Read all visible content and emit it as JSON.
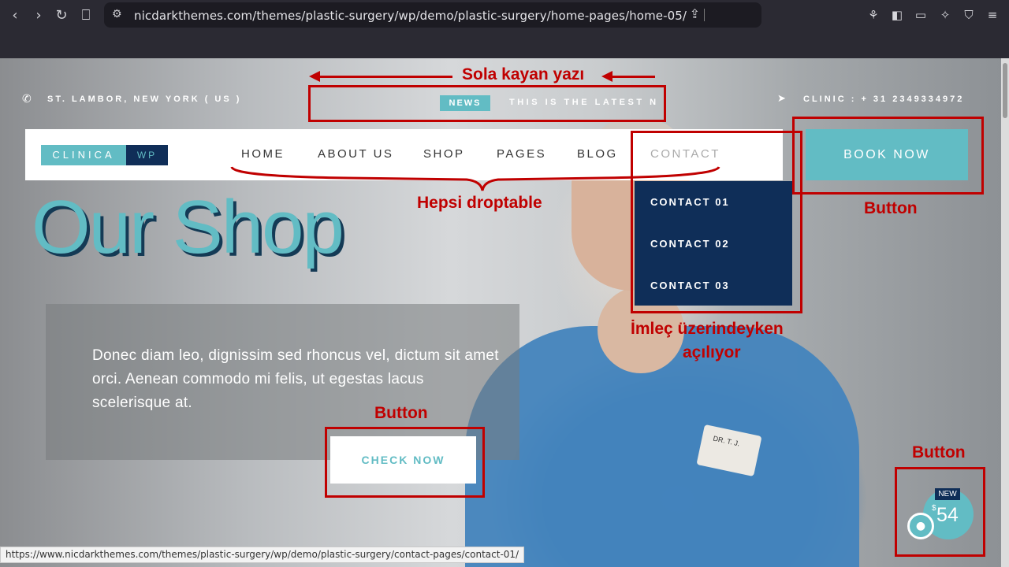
{
  "browser": {
    "url": "nicdarkthemes.com/themes/plastic-surgery/wp/demo/plastic-surgery/home-pages/home-05/",
    "status_url": "https://www.nicdarkthemes.com/themes/plastic-surgery/wp/demo/plastic-surgery/contact-pages/contact-01/"
  },
  "topbar": {
    "address": "ST. LAMBOR, NEW YORK ( US )",
    "news_badge": "NEWS",
    "ticker": "THIS IS THE LATEST NE",
    "clinic_phone": "CLINIC : + 31 2349334972"
  },
  "logo": {
    "part1": "CLINICA",
    "part2": "WP"
  },
  "nav": {
    "items": [
      {
        "label": "HOME"
      },
      {
        "label": "ABOUT US"
      },
      {
        "label": "SHOP"
      },
      {
        "label": "PAGES"
      },
      {
        "label": "BLOG"
      },
      {
        "label": "CONTACT"
      }
    ],
    "dropdown": [
      {
        "label": "CONTACT 01"
      },
      {
        "label": "CONTACT 02"
      },
      {
        "label": "CONTACT 03"
      }
    ],
    "book_now": "BOOK NOW"
  },
  "hero": {
    "title": "Our Shop",
    "text": "Donec diam leo, dignissim sed rhoncus vel, dictum sit amet orci. Aenean commodo mi felis, ut egestas lacus scelerisque at.",
    "button": "CHECK NOW",
    "badge_name": "DR. T. J."
  },
  "promo": {
    "new": "NEW",
    "currency": "$",
    "price": "54"
  },
  "annotations": {
    "ticker_note": "Sola kayan yazı",
    "nav_note": "Hepsi droptable",
    "dropdown_note_1": "İmleç üzerindeyken",
    "dropdown_note_2": "açılıyor",
    "button_note": "Button"
  },
  "colors": {
    "accent": "#62bcc4",
    "navy": "#0f2e58",
    "annotation": "#c00000"
  }
}
